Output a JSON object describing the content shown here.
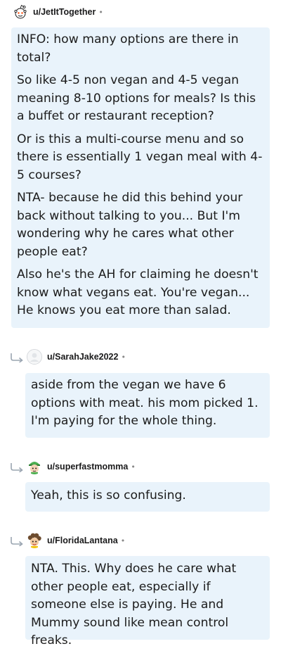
{
  "comments": [
    {
      "username": "u/JetItTogether",
      "separator": "•",
      "avatar": "reddit-snoo-icon",
      "paragraphs": [
        "INFO: how many options are there in total?",
        "So like 4-5 non vegan and 4-5 vegan meaning 8-10 options for meals? Is this a buffet or restaurant reception?",
        "Or is this a multi-course menu and so there is essentially 1 vegan meal with 4-5 courses?",
        "NTA- because he did this behind your back without talking to you... But I'm wondering why he cares what other people eat?",
        "Also he's the AH for claiming he doesn't know what vegans eat. You're vegan... He knows you eat more than salad."
      ]
    },
    {
      "username": "u/SarahJake2022",
      "separator": "•",
      "avatar": "blank-avatar-icon",
      "paragraphs": [
        "aside from the vegan we have 6 options with meat. his mom picked 1. I'm paying for the whole thing."
      ]
    },
    {
      "username": "u/superfastmomma",
      "separator": "•",
      "avatar": "green-hat-avatar-icon",
      "paragraphs": [
        "Yeah, this is so confusing."
      ]
    },
    {
      "username": "u/FloridaLantana",
      "separator": "•",
      "avatar": "curly-hair-avatar-icon",
      "paragraphs": [
        "NTA. This. Why does he care what other people eat, especially if someone else is paying. He and Mummy sound like mean control freaks."
      ]
    }
  ],
  "colors": {
    "bubble_bg": "#e9f3fb",
    "text": "#1c1c1c",
    "username": "#1a1a1b",
    "reply_arrow": "#9aa5b1"
  }
}
